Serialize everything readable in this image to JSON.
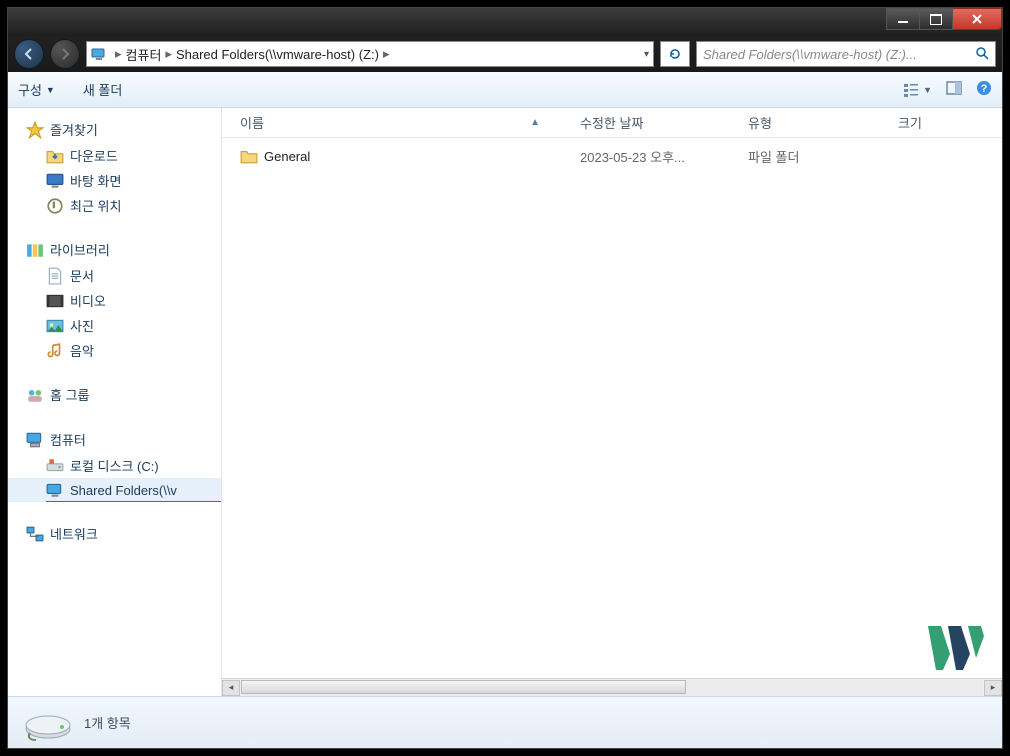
{
  "breadcrumb": {
    "root": "컴퓨터",
    "location": "Shared Folders(\\\\vmware-host) (Z:)"
  },
  "search": {
    "placeholder": "Shared Folders(\\\\vmware-host) (Z:)..."
  },
  "toolbar": {
    "organize": "구성",
    "new_folder": "새 폴더"
  },
  "nav": {
    "favorites": {
      "title": "즐겨찾기",
      "items": [
        "다운로드",
        "바탕 화면",
        "최근 위치"
      ]
    },
    "libraries": {
      "title": "라이브러리",
      "items": [
        "문서",
        "비디오",
        "사진",
        "음악"
      ]
    },
    "homegroup": {
      "title": "홈 그룹"
    },
    "computer": {
      "title": "컴퓨터",
      "items": [
        "로컬 디스크 (C:)",
        "Shared Folders(\\\\v"
      ]
    },
    "network": {
      "title": "네트워크"
    }
  },
  "columns": {
    "name": "이름",
    "date": "수정한 날짜",
    "type": "유형",
    "size": "크기"
  },
  "rows": [
    {
      "name": "General",
      "date": "2023-05-23 오후...",
      "type": "파일 폴더"
    }
  ],
  "status": {
    "text": "1개 항목"
  }
}
